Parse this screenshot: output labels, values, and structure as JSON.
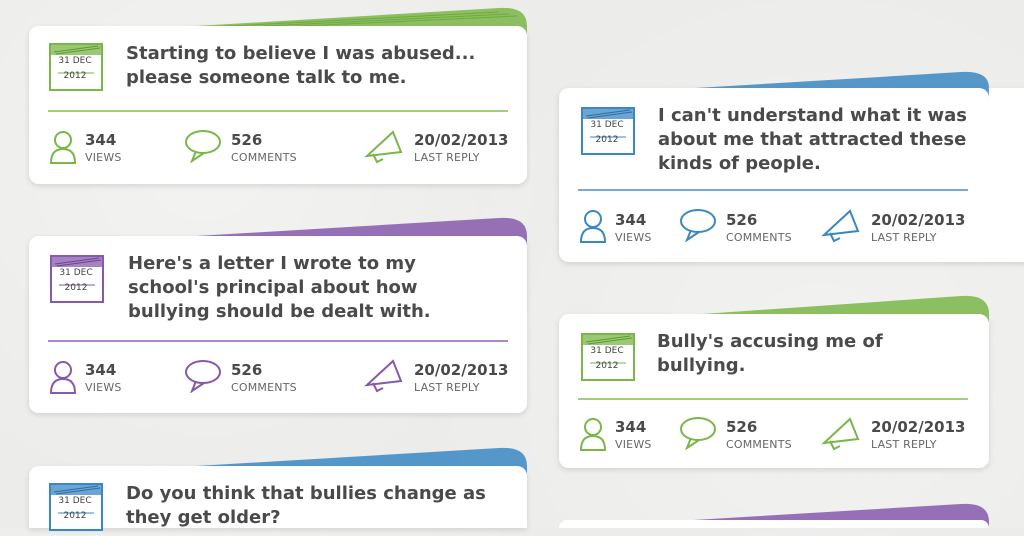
{
  "colors": {
    "green": "#7ab648",
    "blue": "#3b87c4",
    "purple": "#8659ab"
  },
  "stat_labels": {
    "views": "VIEWS",
    "comments": "COMMENTS",
    "last_reply": "LAST REPLY"
  },
  "posts": [
    {
      "title": "Starting to believe I was abused... please someone talk to me.",
      "day": "31 DEC",
      "year": "2012",
      "views": "344",
      "comments": "526",
      "last_reply": "20/02/2013",
      "color": "green"
    },
    {
      "title": "I can't understand what it was about me that attracted these kinds of people.",
      "day": "31 DEC",
      "year": "2012",
      "views": "344",
      "comments": "526",
      "last_reply": "20/02/2013",
      "color": "blue"
    },
    {
      "title": "Here's a letter I wrote to my school's principal about how bullying should be dealt with.",
      "day": "31 DEC",
      "year": "2012",
      "views": "344",
      "comments": "526",
      "last_reply": "20/02/2013",
      "color": "purple"
    },
    {
      "title": "Bully's accusing me of bullying.",
      "day": "31 DEC",
      "year": "2012",
      "views": "344",
      "comments": "526",
      "last_reply": "20/02/2013",
      "color": "green"
    },
    {
      "title": "Do you think that bullies change as they get older?",
      "day": "31 DEC",
      "year": "2012",
      "color": "blue"
    },
    {
      "color": "purple"
    }
  ]
}
